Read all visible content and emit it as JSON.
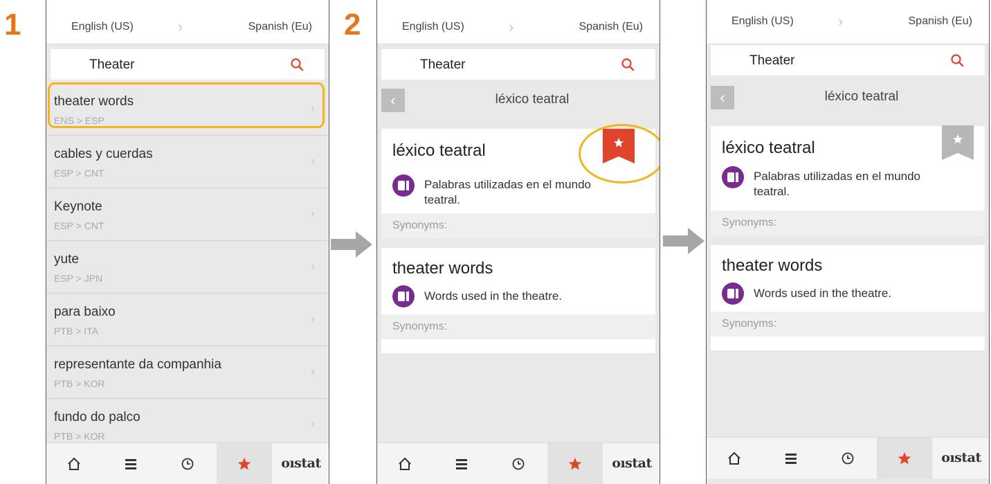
{
  "steps": [
    "1",
    "2"
  ],
  "colors": {
    "accent": "#e8741e",
    "highlight": "#f4b41a",
    "red": "#e0452b",
    "purple": "#7a2b8f",
    "bookmark_inactive": "#b7b7b7"
  },
  "lang": {
    "source": "English (US)",
    "target": "Spanish (Eu)"
  },
  "search": {
    "query": "Theater"
  },
  "list": [
    {
      "title": "theater words",
      "sub": "ENS > ESP"
    },
    {
      "title": "cables y cuerdas",
      "sub": "ESP > CNT"
    },
    {
      "title": "Keynote",
      "sub": "ESP > CNT"
    },
    {
      "title": "yute",
      "sub": "ESP > JPN"
    },
    {
      "title": "para baixo",
      "sub": "PTB > ITA"
    },
    {
      "title": "representante da companhia",
      "sub": "PTB > KOR"
    },
    {
      "title": "fundo do palco",
      "sub": "PTB > KOR"
    }
  ],
  "detail": {
    "header": "léxico teatral",
    "cards": [
      {
        "title": "léxico teatral",
        "desc1": "Palabras utilizadas en el mundo",
        "desc2": "teatral.",
        "syn": "Synonyms:"
      },
      {
        "title": "theater words",
        "desc1": "Words used in the theatre.",
        "syn": "Synonyms:"
      }
    ]
  },
  "tabbar": {
    "icons": [
      "home-icon",
      "list-icon",
      "clock-icon",
      "star-icon"
    ],
    "brand": "oıstat"
  }
}
